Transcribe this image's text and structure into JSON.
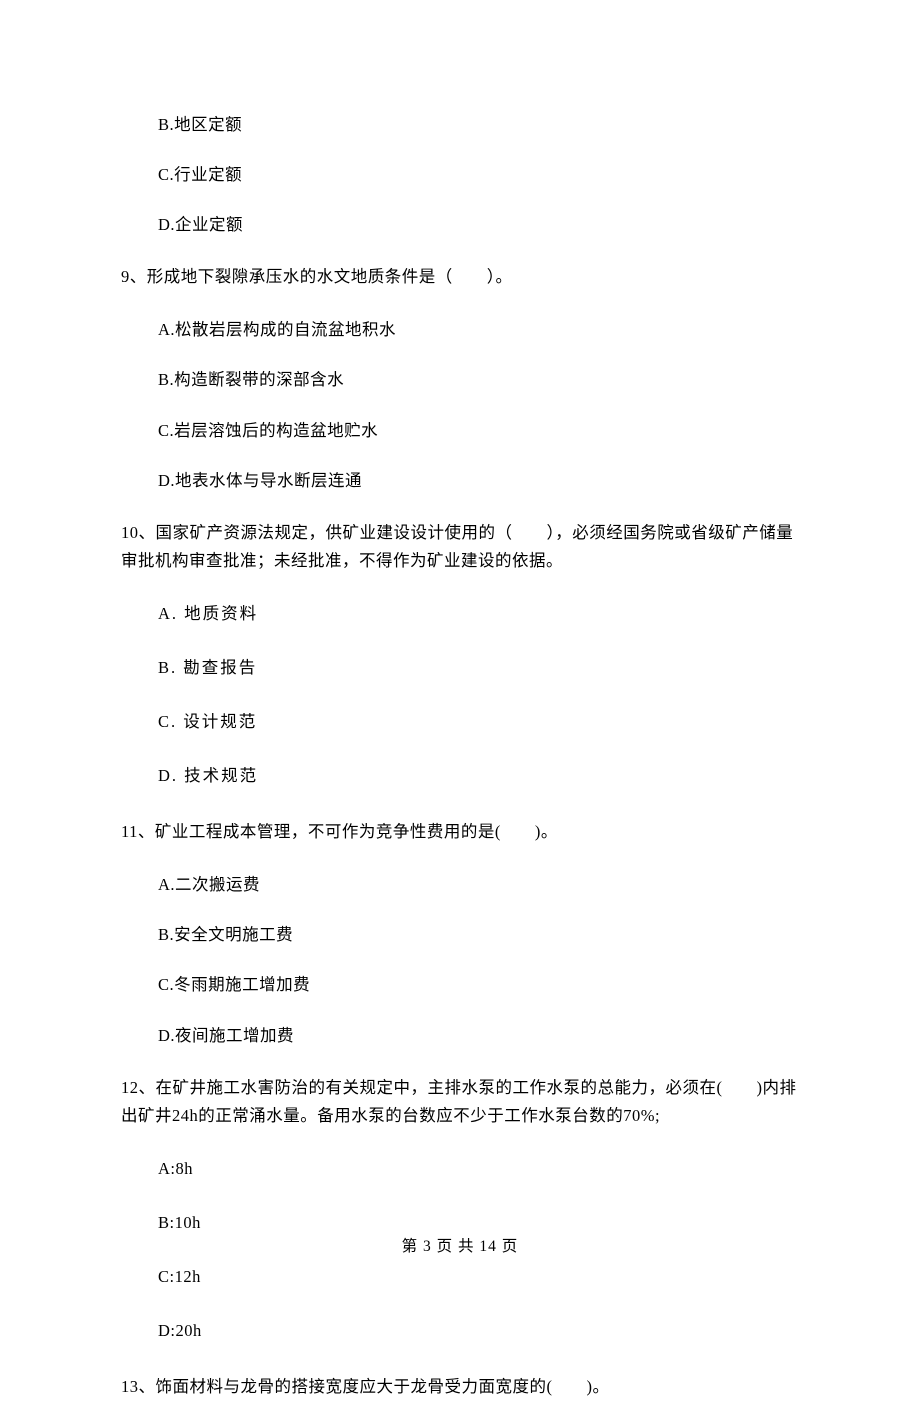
{
  "options_group1": {
    "b": "B.地区定额",
    "c": "C.行业定额",
    "d": "D.企业定额"
  },
  "q9": {
    "text": "9、形成地下裂隙承压水的水文地质条件是（　　）。",
    "a": "A.松散岩层构成的自流盆地积水",
    "b": "B.构造断裂带的深部含水",
    "c": "C.岩层溶蚀后的构造盆地贮水",
    "d": "D.地表水体与导水断层连通"
  },
  "q10": {
    "text": "10、国家矿产资源法规定，供矿业建设设计使用的（　　），必须经国务院或省级矿产储量审批机构审查批准；未经批准，不得作为矿业建设的依据。",
    "a": "A. 地质资料",
    "b": "B. 勘查报告",
    "c": "C. 设计规范",
    "d": "D. 技术规范"
  },
  "q11": {
    "text": "11、矿业工程成本管理，不可作为竞争性费用的是(　　)。",
    "a": "A.二次搬运费",
    "b": "B.安全文明施工费",
    "c": "C.冬雨期施工增加费",
    "d": "D.夜间施工增加费"
  },
  "q12": {
    "text": "12、在矿井施工水害防治的有关规定中，主排水泵的工作水泵的总能力，必须在(　　)内排出矿井24h的正常涌水量。备用水泵的台数应不少于工作水泵台数的70%;",
    "a": "A:8h",
    "b": "B:10h",
    "c": "C:12h",
    "d": "D:20h"
  },
  "q13": {
    "text": "13、饰面材料与龙骨的搭接宽度应大于龙骨受力面宽度的(　　)。"
  },
  "footer": "第 3 页 共 14 页"
}
